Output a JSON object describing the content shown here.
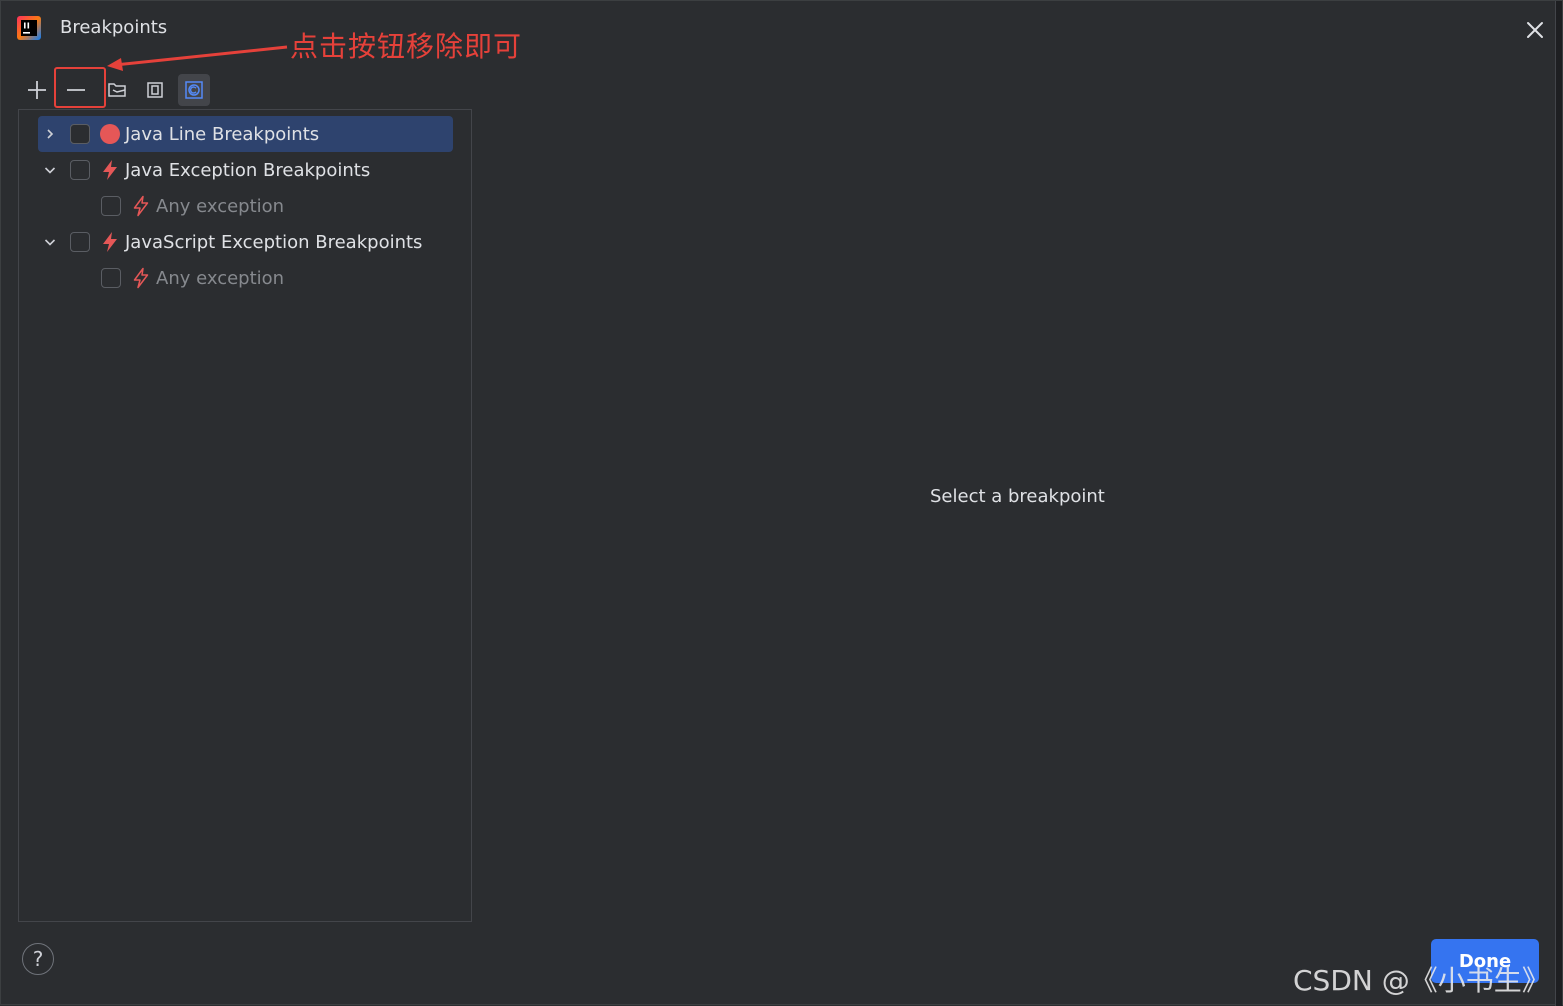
{
  "window": {
    "title": "Breakpoints",
    "icon": "intellij-idea-icon"
  },
  "annotation": {
    "text": "点击按钮移除即可",
    "color": "#e5413a"
  },
  "toolbar": {
    "buttons": [
      {
        "name": "add-button",
        "icon": "plus-icon"
      },
      {
        "name": "remove-button",
        "icon": "minus-icon"
      },
      {
        "name": "group-by-file-button",
        "icon": "folder-icon"
      },
      {
        "name": "group-by-package-button",
        "icon": "package-icon"
      },
      {
        "name": "group-by-class-button",
        "icon": "class-icon",
        "active": true
      }
    ]
  },
  "tree": {
    "items": [
      {
        "label": "Java Line Breakpoints",
        "level": 0,
        "expanded": false,
        "selected": true,
        "icon": "red-dot-icon",
        "checked": false
      },
      {
        "label": "Java Exception Breakpoints",
        "level": 0,
        "expanded": true,
        "selected": false,
        "icon": "lightning-icon",
        "checked": false
      },
      {
        "label": "Any exception",
        "level": 1,
        "muted": true,
        "icon": "lightning-outline-icon",
        "checked": false
      },
      {
        "label": "JavaScript Exception Breakpoints",
        "level": 0,
        "expanded": true,
        "selected": false,
        "icon": "lightning-icon",
        "checked": false
      },
      {
        "label": "Any exception",
        "level": 1,
        "muted": true,
        "icon": "lightning-outline-icon",
        "checked": false
      }
    ]
  },
  "details": {
    "placeholder": "Select a breakpoint"
  },
  "footer": {
    "help_label": "?",
    "done_label": "Done"
  },
  "watermark": "CSDN @《小书生》",
  "colors": {
    "background": "#2b2d30",
    "selection": "#2e436e",
    "accent": "#3574f0",
    "breakpoint": "#e55757"
  }
}
